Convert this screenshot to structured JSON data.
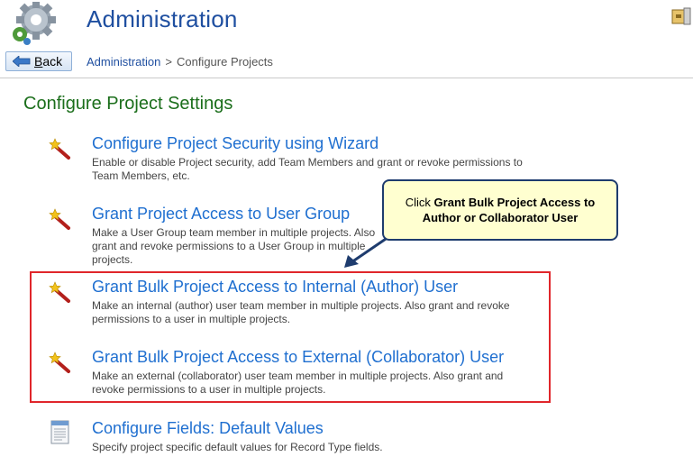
{
  "header": {
    "title": "Administration",
    "back_label": "Back"
  },
  "breadcrumb": {
    "link": "Administration",
    "separator": ">",
    "current": "Configure Projects"
  },
  "section_title": "Configure Project Settings",
  "items": [
    {
      "title": "Configure Project Security using Wizard",
      "desc": "Enable or disable Project security, add Team Members and grant or revoke permissions to Team Members, etc.",
      "icon": "wand-icon"
    },
    {
      "title": "Grant Project Access to User Group",
      "desc": "Make a User Group team member in multiple projects. Also grant and revoke permissions to a User Group in multiple projects.",
      "icon": "wand-icon"
    },
    {
      "title": "Grant Bulk Project Access to Internal (Author) User",
      "desc": "Make an internal (author) user team member in multiple projects. Also grant and revoke permissions to a user in multiple projects.",
      "icon": "wand-icon"
    },
    {
      "title": "Grant Bulk Project Access to External (Collaborator) User",
      "desc": "Make an external (collaborator) user team member in multiple projects. Also grant and revoke permissions to a user in multiple projects.",
      "icon": "wand-icon"
    },
    {
      "title": "Configure Fields: Default Values",
      "desc": "Specify project specific default values for Record Type fields.",
      "icon": "document-icon"
    }
  ],
  "callout": {
    "prefix": "Click ",
    "bold": "Grant Bulk Project Access to Author or Collaborator User"
  },
  "colors": {
    "title_blue": "#1f4fa0",
    "link_blue": "#1f6fd0",
    "section_green": "#1b6e1b",
    "highlight_red": "#e0262b",
    "callout_bg": "#ffffd0",
    "callout_border": "#1e3c6e"
  }
}
